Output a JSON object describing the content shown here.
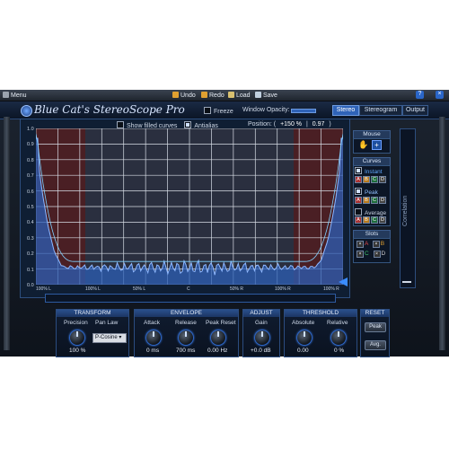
{
  "menu": {
    "menu_label": "Menu",
    "undo_label": "Undo",
    "redo_label": "Redo",
    "load_label": "Load",
    "save_label": "Save",
    "help_icon": "question-icon",
    "close_icon": "close-icon"
  },
  "header": {
    "title": "Blue Cat's StereoScope Pro",
    "freeze_label": "Freeze",
    "window_opacity_label": "Window Opacity:",
    "tabs": [
      {
        "label": "Stereo",
        "active": true
      },
      {
        "label": "Stereogram",
        "active": false
      },
      {
        "label": "Output",
        "active": false
      }
    ]
  },
  "display": {
    "show_filled_curves_label": "Show filled curves",
    "antialias_label": "Antialias",
    "position_label": "Position: (",
    "position_x": "+150 %",
    "position_sep": "|",
    "position_y": "0.97",
    "position_close": ")",
    "y_ticks": [
      "1.0",
      "0.9",
      "0.8",
      "0.7",
      "0.6",
      "0.5",
      "0.4",
      "0.3",
      "0.2",
      "0.1",
      "0.0"
    ],
    "x_ticks": [
      "100% L",
      "100% L",
      "50% L",
      "C",
      "50% R",
      "100% R",
      "100% R"
    ]
  },
  "right_panel": {
    "mouse_label": "Mouse",
    "curves_label": "Curves",
    "instant_label": "Instant",
    "peak_label": "Peak",
    "average_label": "Average",
    "slots_label": "Slots",
    "slot_letters": [
      "A",
      "B",
      "C",
      "D"
    ],
    "correlation_label": "Correlation"
  },
  "controls": {
    "transform": {
      "title": "TRANSFORM",
      "precision_label": "Precision",
      "precision_value": "100 %",
      "pan_law_label": "Pan Law",
      "pan_law_value": "P-Cosine"
    },
    "envelope": {
      "title": "ENVELOPE",
      "attack_label": "Attack",
      "attack_value": "0 ms",
      "release_label": "Release",
      "release_value": "700 ms",
      "peak_reset_label": "Peak Reset",
      "peak_reset_value": "0.00 Hz"
    },
    "adjust": {
      "title": "ADJUST",
      "gain_label": "Gain",
      "gain_value": "+0.0 dB"
    },
    "threshold": {
      "title": "THRESHOLD",
      "absolute_label": "Absolute",
      "absolute_value": "0.00",
      "relative_label": "Relative",
      "relative_value": "0 %"
    },
    "reset": {
      "title": "RESET",
      "peak_button": "Peak",
      "avg_button": "Avg."
    }
  },
  "colors": {
    "accent": "#2f63b8",
    "panel_bg": "#0e131b",
    "plot_bg": "#2a2f3f",
    "plot_red": "#4a1f24",
    "curve_fill": "#2c5fb5",
    "curve_line": "#8fb8ff"
  }
}
